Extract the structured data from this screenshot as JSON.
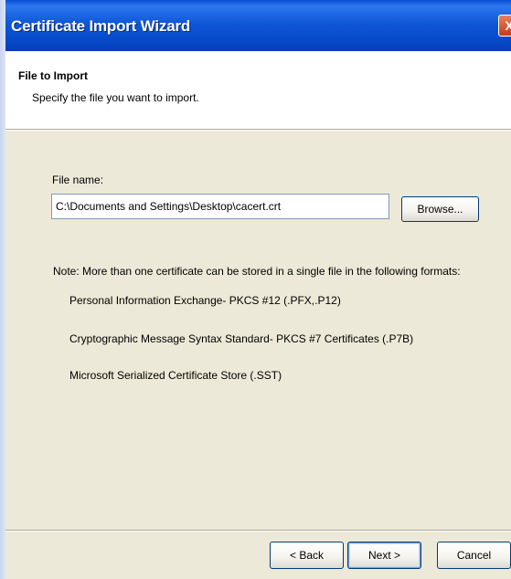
{
  "window": {
    "title": "Certificate Import Wizard",
    "close_glyph": "X"
  },
  "header": {
    "title": "File to Import",
    "subtitle": "Specify the file you want to import."
  },
  "form": {
    "file_name_label": "File name:",
    "file_name_value": "C:\\Documents and Settings\\Desktop\\cacert.crt",
    "browse_label": "Browse..."
  },
  "note": {
    "text": "Note:  More than one certificate can be stored in a single file in the following formats:",
    "formats": [
      "Personal Information Exchange- PKCS #12 (.PFX,.P12)",
      "Cryptographic Message Syntax Standard- PKCS #7 Certificates (.P7B)",
      "Microsoft Serialized Certificate Store (.SST)"
    ]
  },
  "buttons": {
    "back": "< Back",
    "next": "Next >",
    "cancel": "Cancel"
  },
  "colors": {
    "titlebar": "#0649c8",
    "close": "#c7391a",
    "dialog_bg": "#ece9d8",
    "header_bg": "#ffffff"
  }
}
